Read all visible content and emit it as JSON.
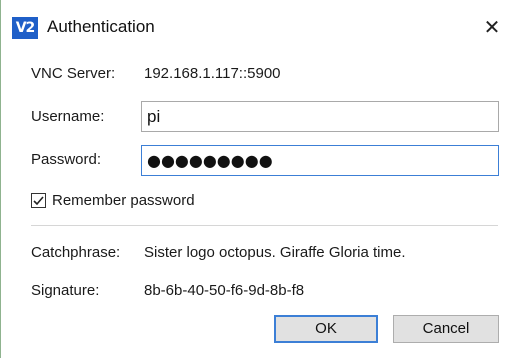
{
  "window": {
    "title": "Authentication",
    "app_icon_text": "V2",
    "app_icon_name": "vnc-viewer-icon",
    "close_glyph": "✕"
  },
  "server": {
    "label": "VNC Server:",
    "value": "192.168.1.117::5900"
  },
  "username": {
    "label": "Username:",
    "value": "pi"
  },
  "password": {
    "label": "Password:",
    "masked_value": "●●●●●●●●●"
  },
  "remember": {
    "label": "Remember password",
    "checked": true
  },
  "catchphrase": {
    "label": "Catchphrase:",
    "value": "Sister logo octopus. Giraffe Gloria time."
  },
  "signature": {
    "label": "Signature:",
    "value": "8b-6b-40-50-f6-9d-8b-f8"
  },
  "buttons": {
    "ok": "OK",
    "cancel": "Cancel"
  },
  "colors": {
    "accent": "#3c7fd6",
    "app_icon_bg": "#1f5fc8",
    "button_bg": "#e1e1e1"
  }
}
